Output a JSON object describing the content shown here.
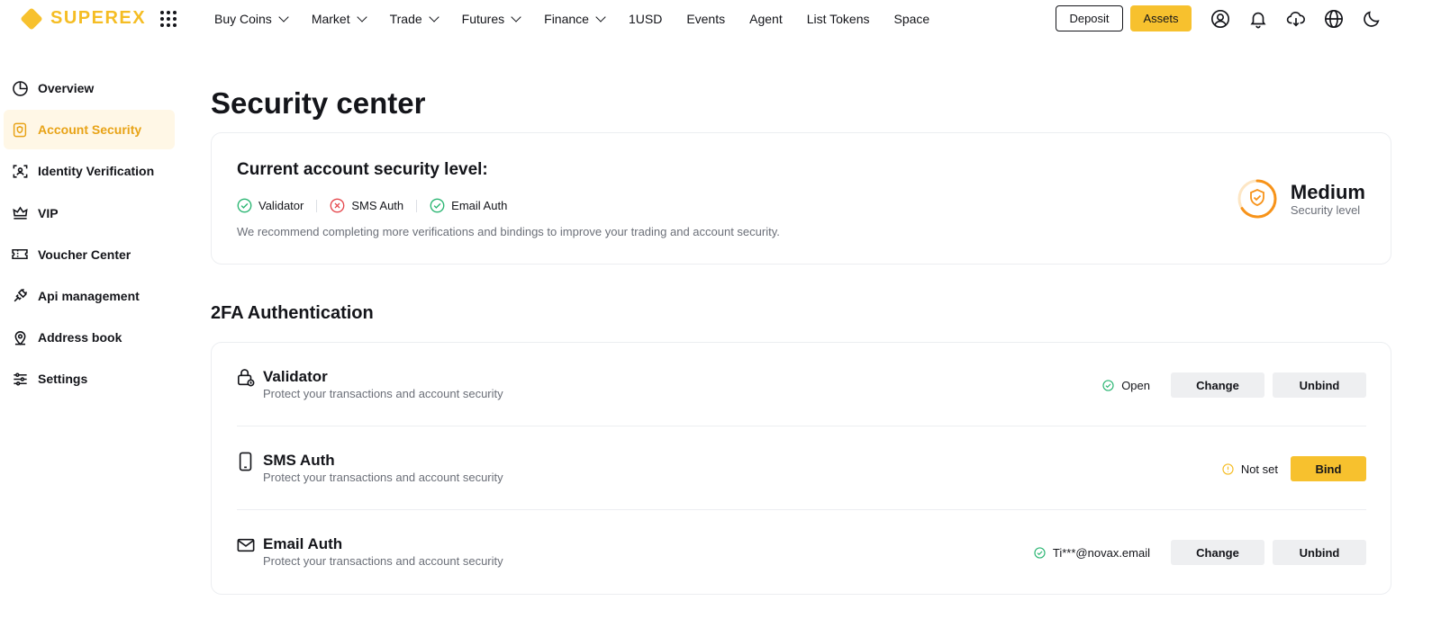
{
  "brand": {
    "name": "SUPEREX",
    "accent": "#f7c12e"
  },
  "nav": {
    "items": [
      {
        "label": "Buy Coins",
        "dropdown": true
      },
      {
        "label": "Market",
        "dropdown": true
      },
      {
        "label": "Trade",
        "dropdown": true
      },
      {
        "label": "Futures",
        "dropdown": true
      },
      {
        "label": "Finance",
        "dropdown": true
      },
      {
        "label": "1USD",
        "dropdown": false
      },
      {
        "label": "Events",
        "dropdown": false
      },
      {
        "label": "Agent",
        "dropdown": false
      },
      {
        "label": "List Tokens",
        "dropdown": false
      },
      {
        "label": "Space",
        "dropdown": false
      }
    ],
    "deposit_label": "Deposit",
    "assets_label": "Assets",
    "icons": [
      "user-icon",
      "bell-icon",
      "download-icon",
      "globe-icon",
      "moon-icon"
    ]
  },
  "sidebar": {
    "items": [
      {
        "label": "Overview",
        "icon": "pie-chart-icon",
        "active": false
      },
      {
        "label": "Account Security",
        "icon": "shield-icon",
        "active": true
      },
      {
        "label": "Identity Verification",
        "icon": "id-scan-icon",
        "active": false
      },
      {
        "label": "VIP",
        "icon": "crown-icon",
        "active": false
      },
      {
        "label": "Voucher Center",
        "icon": "ticket-icon",
        "active": false
      },
      {
        "label": "Api management",
        "icon": "plug-icon",
        "active": false
      },
      {
        "label": "Address book",
        "icon": "location-pin-icon",
        "active": false
      },
      {
        "label": "Settings",
        "icon": "sliders-icon",
        "active": false
      }
    ]
  },
  "main": {
    "title": "Security center",
    "level_card": {
      "title": "Current account security level:",
      "checks": [
        {
          "label": "Validator",
          "status": "ok"
        },
        {
          "label": "SMS Auth",
          "status": "missing"
        },
        {
          "label": "Email Auth",
          "status": "ok"
        }
      ],
      "hint": "We recommend completing more verifications and bindings to improve your trading and account security.",
      "level": "Medium",
      "level_sub": "Security level",
      "level_fraction": 0.66
    },
    "twofa": {
      "title": "2FA Authentication",
      "rows": [
        {
          "name": "Validator",
          "desc": "Protect your transactions and account security",
          "status": "Open",
          "status_type": "ok",
          "buttons": [
            "Change",
            "Unbind"
          ]
        },
        {
          "name": "SMS Auth",
          "desc": "Protect your transactions and account security",
          "status": "Not set",
          "status_type": "warn",
          "buttons": [
            "Bind"
          ]
        },
        {
          "name": "Email Auth",
          "desc": "Protect your transactions and account security",
          "status": "Ti***@novax.email",
          "status_type": "ok",
          "buttons": [
            "Change",
            "Unbind"
          ]
        }
      ]
    }
  },
  "colors": {
    "ok": "#2bb673",
    "error": "#e5484d",
    "warn": "#f5bd24",
    "level": "#f7931a"
  }
}
